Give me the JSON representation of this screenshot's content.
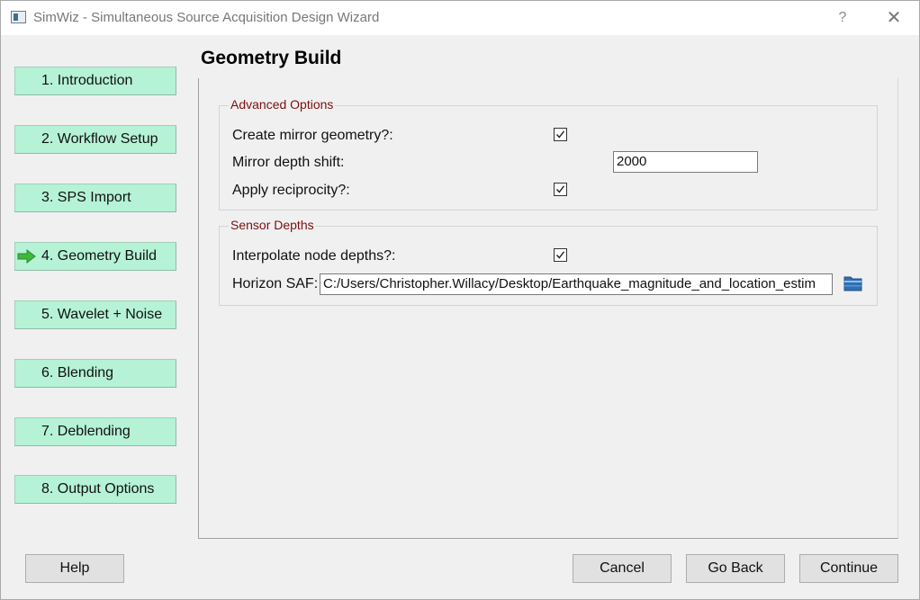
{
  "window": {
    "title": "SimWiz - Simultaneous Source Acquisition Design Wizard",
    "help_glyph": "?",
    "close_glyph": "✕"
  },
  "nav": {
    "items": [
      {
        "label": "1. Introduction"
      },
      {
        "label": "2. Workflow Setup"
      },
      {
        "label": "3. SPS Import"
      },
      {
        "label": "4. Geometry Build",
        "current": true,
        "icon": "green-arrow-icon"
      },
      {
        "label": "5. Wavelet + Noise"
      },
      {
        "label": "6. Blending"
      },
      {
        "label": "7. Deblending"
      },
      {
        "label": "8. Output Options"
      }
    ]
  },
  "page": {
    "title": "Geometry Build"
  },
  "advanced": {
    "title": "Advanced Options",
    "mirror_label": "Create mirror geometry?:",
    "mirror_checked": true,
    "shift_label": "Mirror depth shift:",
    "shift_value": "2000",
    "reciprocity_label": "Apply reciprocity?:",
    "reciprocity_checked": true
  },
  "sensor": {
    "title": "Sensor Depths",
    "interpolate_label": "Interpolate node depths?:",
    "interpolate_checked": true,
    "horizon_label": "Horizon SAF:",
    "horizon_value": "C:/Users/Christopher.Willacy/Desktop/Earthquake_magnitude_and_location_estim",
    "browse_icon": "folder-icon"
  },
  "buttons": {
    "help": "Help",
    "cancel": "Cancel",
    "back": "Go Back",
    "continue": "Continue"
  },
  "colors": {
    "nav_bg": "#b5f2d6",
    "group_title": "#7a1010",
    "arrow": "#3db83d"
  }
}
